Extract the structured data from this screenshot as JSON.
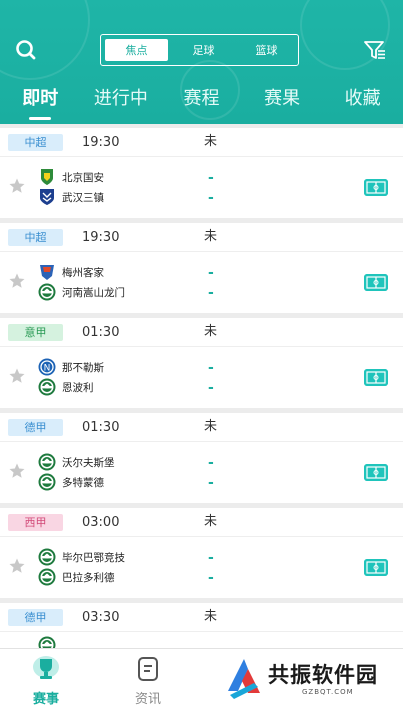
{
  "colors": {
    "accent": "#1aae9f",
    "header": "#1fb5a7",
    "zhongchao_bg": "#d9edfb",
    "yijia_bg": "#d5f2df",
    "dejia_bg": "#d9edfb",
    "xijia_bg": "#f9d6e3"
  },
  "header": {
    "segments": [
      "焦点",
      "足球",
      "篮球"
    ],
    "tabs": [
      "即时",
      "进行中",
      "赛程",
      "赛果",
      "收藏"
    ]
  },
  "matches": [
    {
      "league": "中超",
      "time": "19:30",
      "status": "未",
      "home": "北京国安",
      "away": "武汉三镇",
      "home_score": "-",
      "away_score": "-",
      "league_bg": "#d9edfb",
      "league_color": "#3a8fd0",
      "home_icon": "beijing-guoan-logo-icon",
      "away_icon": "wuhan-sanzhen-logo-icon"
    },
    {
      "league": "中超",
      "time": "19:30",
      "status": "未",
      "home": "梅州客家",
      "away": "河南嵩山龙门",
      "home_score": "-",
      "away_score": "-",
      "league_bg": "#d9edfb",
      "league_color": "#3a8fd0",
      "home_icon": "meizhou-kejia-logo-icon",
      "away_icon": "soccer-logo-icon"
    },
    {
      "league": "意甲",
      "time": "01:30",
      "status": "未",
      "home": "那不勒斯",
      "away": "恩波利",
      "home_score": "-",
      "away_score": "-",
      "league_bg": "#d5f2df",
      "league_color": "#2a9a55",
      "home_icon": "napoli-logo-icon",
      "away_icon": "soccer-logo-icon"
    },
    {
      "league": "德甲",
      "time": "01:30",
      "status": "未",
      "home": "沃尔夫斯堡",
      "away": "多特蒙德",
      "home_score": "-",
      "away_score": "-",
      "league_bg": "#d9edfb",
      "league_color": "#3a8fd0",
      "home_icon": "soccer-logo-icon",
      "away_icon": "soccer-logo-icon"
    },
    {
      "league": "西甲",
      "time": "03:00",
      "status": "未",
      "home": "毕尔巴鄂竞技",
      "away": "巴拉多利德",
      "home_score": "-",
      "away_score": "-",
      "league_bg": "#f9d6e3",
      "league_color": "#d24a78",
      "home_icon": "soccer-logo-icon",
      "away_icon": "soccer-logo-icon"
    },
    {
      "league": "德甲",
      "time": "03:30",
      "status": "未",
      "home": "",
      "away": "",
      "home_score": "",
      "away_score": "",
      "league_bg": "#d9edfb",
      "league_color": "#3a8fd0",
      "home_icon": "soccer-logo-icon",
      "away_icon": "soccer-logo-icon"
    }
  ],
  "bottom_nav": [
    {
      "label": "赛事",
      "icon": "trophy-icon",
      "active": true
    },
    {
      "label": "资讯",
      "icon": "news-icon",
      "active": false
    }
  ],
  "watermark": {
    "title": "共振软件园",
    "subtitle": "GZBQT.COM"
  }
}
